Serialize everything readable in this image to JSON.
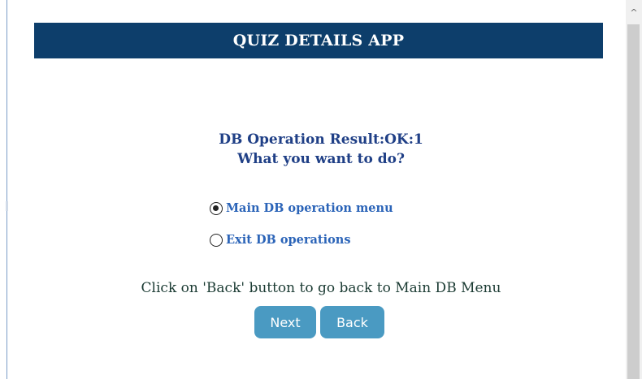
{
  "header": {
    "title": "QUIZ DETAILS APP"
  },
  "result": {
    "status_text": "DB Operation Result:OK:1",
    "question": "What you want to do?"
  },
  "options": [
    {
      "label": "Main DB operation menu",
      "selected": true
    },
    {
      "label": "Exit DB operations",
      "selected": false
    }
  ],
  "hint_text": "Click on 'Back' button to go back to Main DB Menu",
  "buttons": {
    "next_label": "Next",
    "back_label": "Back"
  },
  "scrollbar": {
    "up_arrow": "^"
  },
  "colors": {
    "header_bg": "#0d3e6b",
    "heading_text": "#1f3f86",
    "option_text": "#2b64b8",
    "button_bg": "#4a9ac2"
  }
}
